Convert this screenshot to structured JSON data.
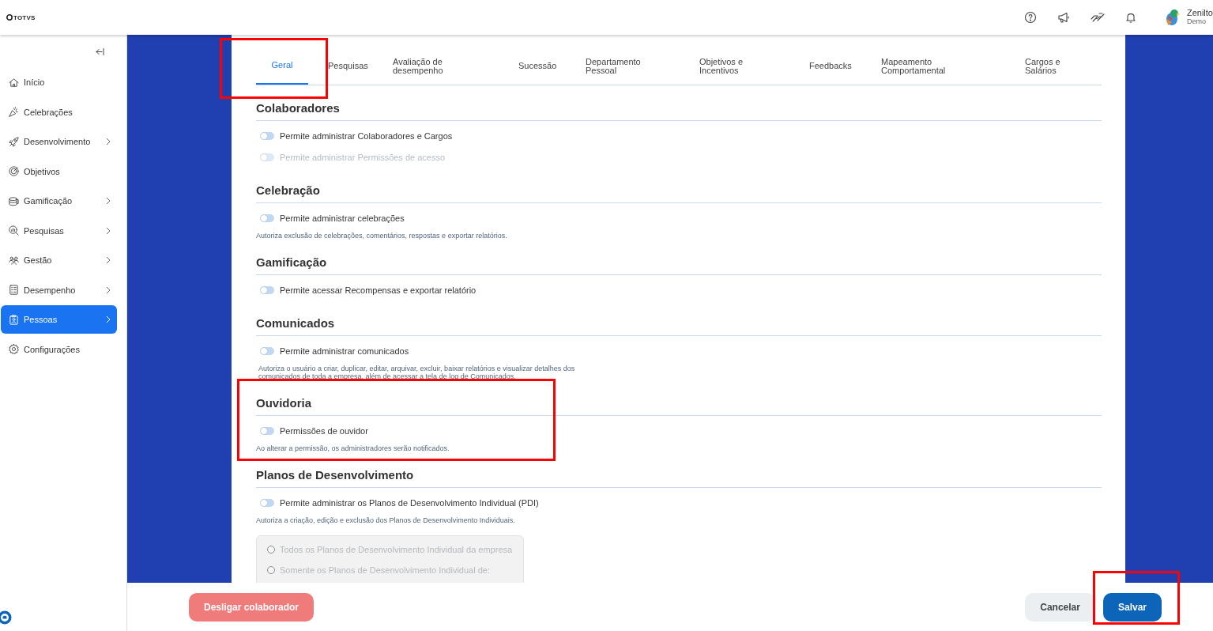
{
  "header": {
    "logo": "TOTVS",
    "user": {
      "name": "Zenilto",
      "role": "Demo"
    }
  },
  "sidebar": {
    "items": [
      {
        "label": "Início",
        "has_submenu": false,
        "selected": false
      },
      {
        "label": "Celebrações",
        "has_submenu": false,
        "selected": false
      },
      {
        "label": "Desenvolvimento",
        "has_submenu": true,
        "selected": false
      },
      {
        "label": "Objetivos",
        "has_submenu": false,
        "selected": false
      },
      {
        "label": "Gamificação",
        "has_submenu": true,
        "selected": false
      },
      {
        "label": "Pesquisas",
        "has_submenu": true,
        "selected": false
      },
      {
        "label": "Gestão",
        "has_submenu": true,
        "selected": false
      },
      {
        "label": "Desempenho",
        "has_submenu": true,
        "selected": false
      },
      {
        "label": "Pessoas",
        "has_submenu": true,
        "selected": true
      },
      {
        "label": "Configurações",
        "has_submenu": false,
        "selected": false
      }
    ]
  },
  "tabs": [
    {
      "label": "Geral",
      "selected": true
    },
    {
      "label": "Pesquisas",
      "selected": false
    },
    {
      "label": "Avaliação de desempenho",
      "selected": false
    },
    {
      "label": "Sucessão",
      "selected": false
    },
    {
      "label": "Departamento Pessoal",
      "selected": false
    },
    {
      "label": "Objetivos e Incentivos",
      "selected": false
    },
    {
      "label": "Feedbacks",
      "selected": false
    },
    {
      "label": "Mapeamento Comportamental",
      "selected": false
    },
    {
      "label": "Cargos e Salários",
      "selected": false
    }
  ],
  "sections": [
    {
      "title": "Colaboradores",
      "toggles": [
        {
          "label": "Permite administrar Colaboradores e Cargos",
          "on": false,
          "disabled": false
        },
        {
          "label": "Permite administrar Permissões de acesso",
          "on": false,
          "disabled": true
        }
      ]
    },
    {
      "title": "Celebração",
      "toggles": [
        {
          "label": "Permite administrar celebrações",
          "on": false,
          "disabled": false
        }
      ],
      "description": "Autoriza exclusão de celebrações, comentários, respostas e exportar relatórios."
    },
    {
      "title": "Gamificação",
      "toggles": [
        {
          "label": "Permite acessar Recompensas e exportar relatório",
          "on": false,
          "disabled": false
        }
      ]
    },
    {
      "title": "Comunicados",
      "toggles": [
        {
          "label": "Permite administrar comunicados",
          "on": false,
          "disabled": false
        }
      ],
      "description": "Autoriza o usuário a criar, duplicar, editar, arquivar, excluir, baixar relatórios e visualizar detalhes dos comunicados de toda a empresa, além de acessar a tela de log de Comunicados."
    },
    {
      "title": "Ouvidoria",
      "toggles": [
        {
          "label": "Permissões de ouvidor",
          "on": false,
          "disabled": false
        }
      ],
      "description": "Ao alterar a permissão, os administradores serão notificados."
    },
    {
      "title": "Planos de Desenvolvimento",
      "toggles": [
        {
          "label": "Permite administrar os Planos de Desenvolvimento Individual (PDI)",
          "on": false,
          "disabled": false
        }
      ],
      "description": "Autoriza a criação, edição e exclusão dos Planos de Desenvolvimento Individuais.",
      "radios": [
        {
          "label": "Todos os Planos de Desenvolvimento Individual da empresa",
          "selected": false,
          "disabled": true
        },
        {
          "label": "Somente os Planos de Desenvolvimento Individual de:",
          "selected": false,
          "disabled": true
        }
      ]
    }
  ],
  "footer": {
    "dismiss_button": "Desligar colaborador",
    "cancel_button": "Cancelar",
    "save_button": "Salvar"
  }
}
